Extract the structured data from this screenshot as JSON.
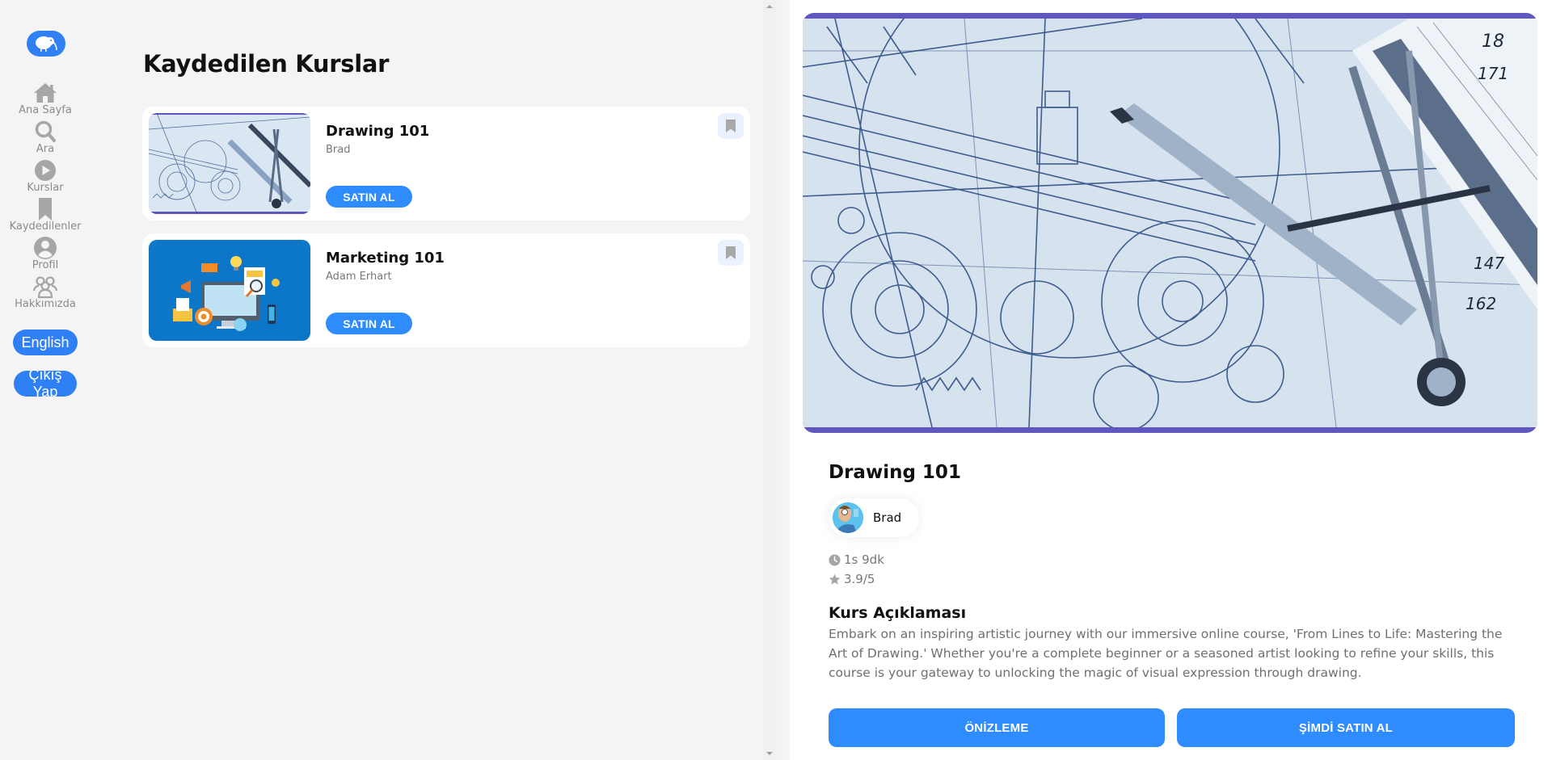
{
  "sidebar": {
    "logo": "kiwi-logo",
    "items": [
      {
        "label": "Ana Sayfa",
        "icon": "home-icon"
      },
      {
        "label": "Ara",
        "icon": "search-icon"
      },
      {
        "label": "Kurslar",
        "icon": "play-circle-icon"
      },
      {
        "label": "Kaydedilenler",
        "icon": "bookmark-icon"
      },
      {
        "label": "Profil",
        "icon": "user-circle-icon"
      },
      {
        "label": "Hakkımızda",
        "icon": "users-icon"
      }
    ],
    "language_button": "English",
    "logout_button": "Çıkış Yap"
  },
  "main": {
    "title": "Kaydedilen Kurslar",
    "courses": [
      {
        "title": "Drawing 101",
        "author": "Brad",
        "buy_label": "SATIN AL",
        "thumbnail": "technical-drawing-blueprint"
      },
      {
        "title": "Marketing 101",
        "author": "Adam Erhart",
        "buy_label": "SATIN AL",
        "thumbnail": "digital-marketing-illustration"
      }
    ]
  },
  "detail": {
    "title": "Drawing 101",
    "author": "Brad",
    "duration": "1s 9dk",
    "rating": "3.9/5",
    "description_title": "Kurs Açıklaması",
    "description": "Embark on an inspiring artistic journey with our immersive online course, 'From Lines to Life: Mastering the Art of Drawing.' Whether you're a complete beginner or a seasoned artist looking to refine your skills, this course is your gateway to unlocking the magic of visual expression through drawing.",
    "preview_button": "ÖNİZLEME",
    "buy_now_button": "ŞİMDİ SATIN AL"
  },
  "colors": {
    "accent": "#2f8cff",
    "sidebar_accent": "#2f80f5",
    "hero_border": "#5d57bf",
    "background": "#f4f4f4"
  }
}
